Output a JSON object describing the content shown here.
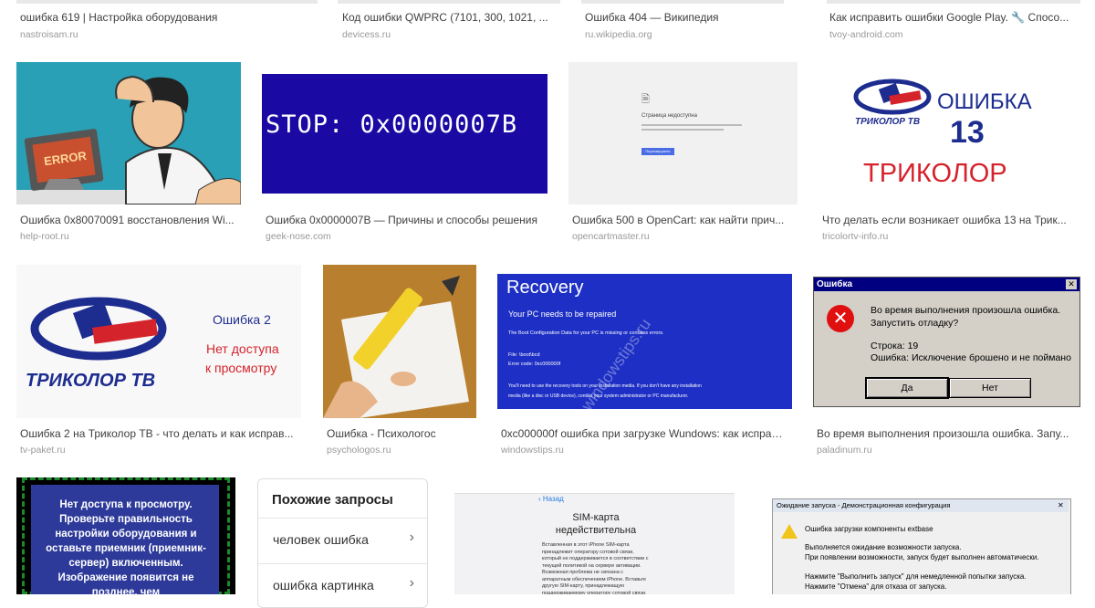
{
  "top_row": [
    {
      "caption": "ошибка 619 | Настройка оборудования",
      "domain": "nastroisam.ru"
    },
    {
      "caption": "Код ошибки QWPRC (7101, 300, 1021, ...",
      "domain": "devicess.ru"
    },
    {
      "caption": "Ошибка 404 — Википедия",
      "domain": "ru.wikipedia.org"
    },
    {
      "caption": "Как исправить ошибки Google Play. 🔧 Спосо...",
      "domain": "tvoy-android.com"
    }
  ],
  "row2": [
    {
      "caption": "Ошибка 0x80070091 восстановления Wi...",
      "domain": "help-root.ru",
      "thumb_text": "ERROR"
    },
    {
      "caption": "Ошибка 0x0000007B — Причины и способы решения",
      "domain": "geek-nose.com",
      "thumb_text": "STOP: 0x0000007B"
    },
    {
      "caption": "Ошибка 500 в OpenCart: как найти прич...",
      "domain": "opencartmaster.ru",
      "thumb_text": "Страница недоступна",
      "thumb_button": "Перезагрузить"
    },
    {
      "caption": "Что делать если возникает ошибка 13 на Трик...",
      "domain": "tricolortv-info.ru",
      "thumb_line1": "ОШИБКА",
      "thumb_line2": "13",
      "thumb_line3": "ТРИКОЛОР",
      "logo_text": "ТРИКОЛОР ТВ"
    }
  ],
  "row3": [
    {
      "caption": "Ошибка 2 на Триколор ТВ - что делать и как исправ...",
      "domain": "tv-paket.ru",
      "thumb_line1": "Ошибка 2",
      "thumb_line2": "Нет доступа",
      "thumb_line3": "к просмотру",
      "logo_text": "ТРИКОЛОР ТВ"
    },
    {
      "caption": "Ошибка - Психологос",
      "domain": "psychologos.ru"
    },
    {
      "caption": "0xc000000f ошибка при загрузке Wundows: как исправ...",
      "domain": "windowstips.ru",
      "thumb_title": "Recovery",
      "thumb_sub": "Your PC needs to be repaired",
      "thumb_l1": "The Boot Configuration Data for your PC is missing or contains errors.",
      "thumb_l2": "File: \\boot\\bcd",
      "thumb_l3": "Error code: 0xc000000f",
      "thumb_l4": "You'll need to use the recovery tools on your installation media. If you don't have any installation",
      "thumb_l5": "media (like a disc or USB device), contact your system administrator or PC manufacturer.",
      "watermark": "windowstips.ru"
    },
    {
      "caption": "Во время выполнения произошла ошибка. Запу...",
      "domain": "paladinum.ru",
      "dlg_title": "Ошибка",
      "dlg_l1": "Во время выполнения произошла ошибка.",
      "dlg_l2": "Запустить отладку?",
      "dlg_l3": "Строка: 19",
      "dlg_l4": "Ошибка: Исключение брошено и не поймано",
      "btn_yes": "Да",
      "btn_no": "Нет"
    }
  ],
  "row4": {
    "tv_text": "Нет доступа к просмотру. Проверьте правильность настройки оборудования и оставьте приемник (приемник-сервер) включенным. Изображение появится не позднее, чем",
    "related_title": "Похожие запросы",
    "related_items": [
      "человек ошибка",
      "ошибка картинка"
    ],
    "sim_back": "Назад",
    "sim_title": "SIM-карта недействительна",
    "sim_body": "Вставленная в этот iPhone SIM-карта принадлежит оператору сотовой связи, который не поддерживается в соответствии с текущей политикой на сервере активации. Возможная проблема не связана с аппаратным обеспечением iPhone. Вставьте другую SIM-карту, принадлежащую поддерживаемому оператору сотовой связи.",
    "launch_title": "Ожидание запуска - Демонстрационная конфигурация",
    "launch_l1": "Ошибка загрузки компоненты extbase",
    "launch_l2": "Выполняется ожидание возможности запуска.",
    "launch_l3": "При появлении возможности, запуск будет выполнен автоматически.",
    "launch_l4": "Нажмите \"Выполнить запуск\" для немедленной попытки запуска.",
    "launch_l5": "Нажмите \"Отмена\" для отказа от запуска."
  }
}
